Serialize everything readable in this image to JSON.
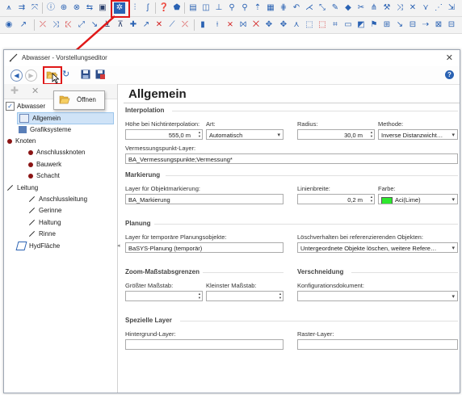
{
  "app_toolbar_row1": {
    "icons": [
      "edit-line-icon",
      "add-node-icon",
      "snap-icon",
      "info-icon",
      "target-icon",
      "globe-icon",
      "swap-icon",
      "toolbox-icon",
      "settings-gear-icon",
      "chart-icon",
      "help-icon",
      "pages-icon",
      "buffer-icon",
      "measure-icon",
      "zoom-icon",
      "north-icon",
      "layers-icon",
      "grid-icon",
      "undo-icon",
      "split-icon",
      "pen-icon",
      "scissors-icon",
      "tree-icon",
      "wrench-icon",
      "arrows-icon",
      "more-icon"
    ]
  },
  "app_toolbar_row2": {
    "icons": [
      "draw-icon",
      "add-vertex-icon",
      "delete-vertex-icon",
      "move-icon",
      "rotate-icon",
      "scale-icon",
      "copy-icon",
      "node-icon",
      "join-icon",
      "split-line-icon",
      "point-icon",
      "area-icon",
      "union-icon",
      "clip-icon",
      "select-icon",
      "filter-icon",
      "label-icon",
      "text-icon",
      "export-icon"
    ]
  },
  "dialog": {
    "title": "Abwasser - Vorstellungseditor",
    "close_label": "✕",
    "help_label": "?"
  },
  "context_menu": {
    "item_label": "Öffnen"
  },
  "tree": {
    "items": [
      {
        "label": "Abwasser",
        "icon": "checkbox-icon"
      },
      {
        "label": "Allgemein",
        "icon": "list-icon",
        "selected": true
      },
      {
        "label": "Grafiksysteme",
        "icon": "graphics-icon"
      },
      {
        "label": "Knoten",
        "icon": "node-dot-icon"
      },
      {
        "label": "Anschlussknoten",
        "icon": "node-dot-icon"
      },
      {
        "label": "Bauwerk",
        "icon": "node-dot-icon"
      },
      {
        "label": "Schacht",
        "icon": "node-dot-icon"
      },
      {
        "label": "Leitung",
        "icon": "line-icon"
      },
      {
        "label": "Anschlussleitung",
        "icon": "line-icon"
      },
      {
        "label": "Gerinne",
        "icon": "line-icon"
      },
      {
        "label": "Haltung",
        "icon": "line-icon"
      },
      {
        "label": "Rinne",
        "icon": "line-icon"
      },
      {
        "label": "HydFläche",
        "icon": "area-icon"
      }
    ]
  },
  "main": {
    "header": "Allgemein",
    "interpolation": {
      "title": "Interpolation",
      "hoehe_label": "Höhe bei Nichtinterpolation:",
      "hoehe_value": "555,0 m",
      "art_label": "Art:",
      "art_value": "Automatisch",
      "radius_label": "Radius:",
      "radius_value": "30,0 m",
      "methode_label": "Methode:",
      "methode_value": "Inverse Distanzwicht…",
      "vp_label": "Vermessungspunkt-Layer:",
      "vp_value": "BA_Vermessungspunkte;Vermessung*"
    },
    "markierung": {
      "title": "Markierung",
      "layer_label": "Layer für Objektmarkierung:",
      "layer_value": "BA_Markierung",
      "linienbreite_label": "Linienbreite:",
      "linienbreite_value": "0,2 m",
      "farbe_label": "Farbe:",
      "farbe_value": "Aci(Lime)",
      "farbe_color": "#2ee82e"
    },
    "planung": {
      "title": "Planung",
      "layer_label": "Layer für temporäre Planungsobjekte:",
      "layer_value": "BaSYS-Planung (temporär)",
      "loesch_label": "Löschverhalten bei referenzierenden Objekten:",
      "loesch_value": "Untergeordnete Objekte löschen, weitere Refere…"
    },
    "zoom": {
      "title": "Zoom-Maßstabsgrenzen",
      "groesster_label": "Größter Maßstab:",
      "groesster_value": "",
      "kleinster_label": "Kleinster Maßstab:",
      "kleinster_value": ""
    },
    "verschneidung": {
      "title": "Verschneidung",
      "konfig_label": "Konfigurationsdokument:",
      "konfig_value": ""
    },
    "spezielle": {
      "title": "Spezielle Layer",
      "hintergrund_label": "Hintergrund-Layer:",
      "hintergrund_value": "",
      "raster_label": "Raster-Layer:",
      "raster_value": ""
    }
  }
}
